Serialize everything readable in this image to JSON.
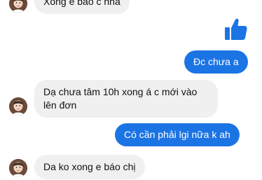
{
  "chat": {
    "messages": [
      {
        "id": "m1",
        "side": "incoming",
        "text": "Xong e báo c nha"
      },
      {
        "id": "m2",
        "side": "outgoing",
        "type": "like",
        "icon": "thumbs-up-icon"
      },
      {
        "id": "m3",
        "side": "outgoing",
        "text": "Đc chưa a"
      },
      {
        "id": "m4",
        "side": "incoming",
        "text": "Dạ chưa tâm 10h xong á c mới vào lên đơn"
      },
      {
        "id": "m5",
        "side": "outgoing",
        "text": "Có cần phải lgi nữa k ah"
      },
      {
        "id": "m6",
        "side": "incoming",
        "text": "Da ko xong e báo chị"
      }
    ]
  },
  "colors": {
    "outgoing_bubble": "#1b74e4",
    "incoming_bubble": "#f1f0f0",
    "like_icon": "#1b74e4"
  }
}
